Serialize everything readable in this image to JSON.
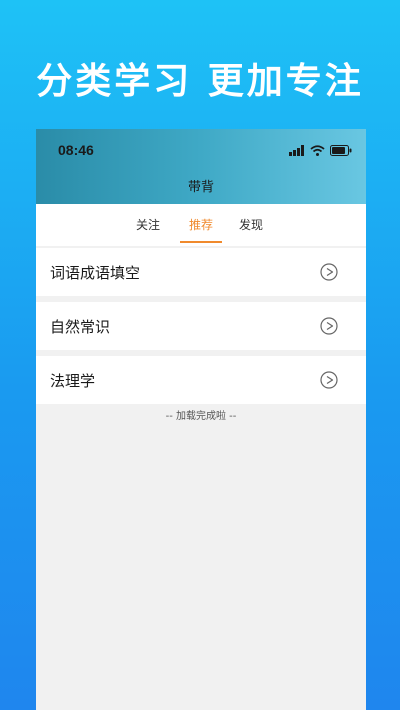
{
  "promo": {
    "headline": "分类学习 更加专注"
  },
  "status_bar": {
    "time": "08:46",
    "icons": [
      "signal-icon",
      "wifi-icon",
      "battery-icon"
    ]
  },
  "nav": {
    "title": "带背"
  },
  "tabs": [
    {
      "label": "关注",
      "active": false
    },
    {
      "label": "推荐",
      "active": true
    },
    {
      "label": "发现",
      "active": false
    }
  ],
  "list": [
    {
      "label": "词语成语填空",
      "icon": "play-icon"
    },
    {
      "label": "自然常识",
      "icon": "play-icon"
    },
    {
      "label": "法理学",
      "icon": "play-icon"
    }
  ],
  "footer": {
    "loaded_text": "-- 加载完成啦 --"
  },
  "colors": {
    "accent": "#f08a2d",
    "background_top": "#1ec2f6",
    "background_bottom": "#1f86ee"
  }
}
